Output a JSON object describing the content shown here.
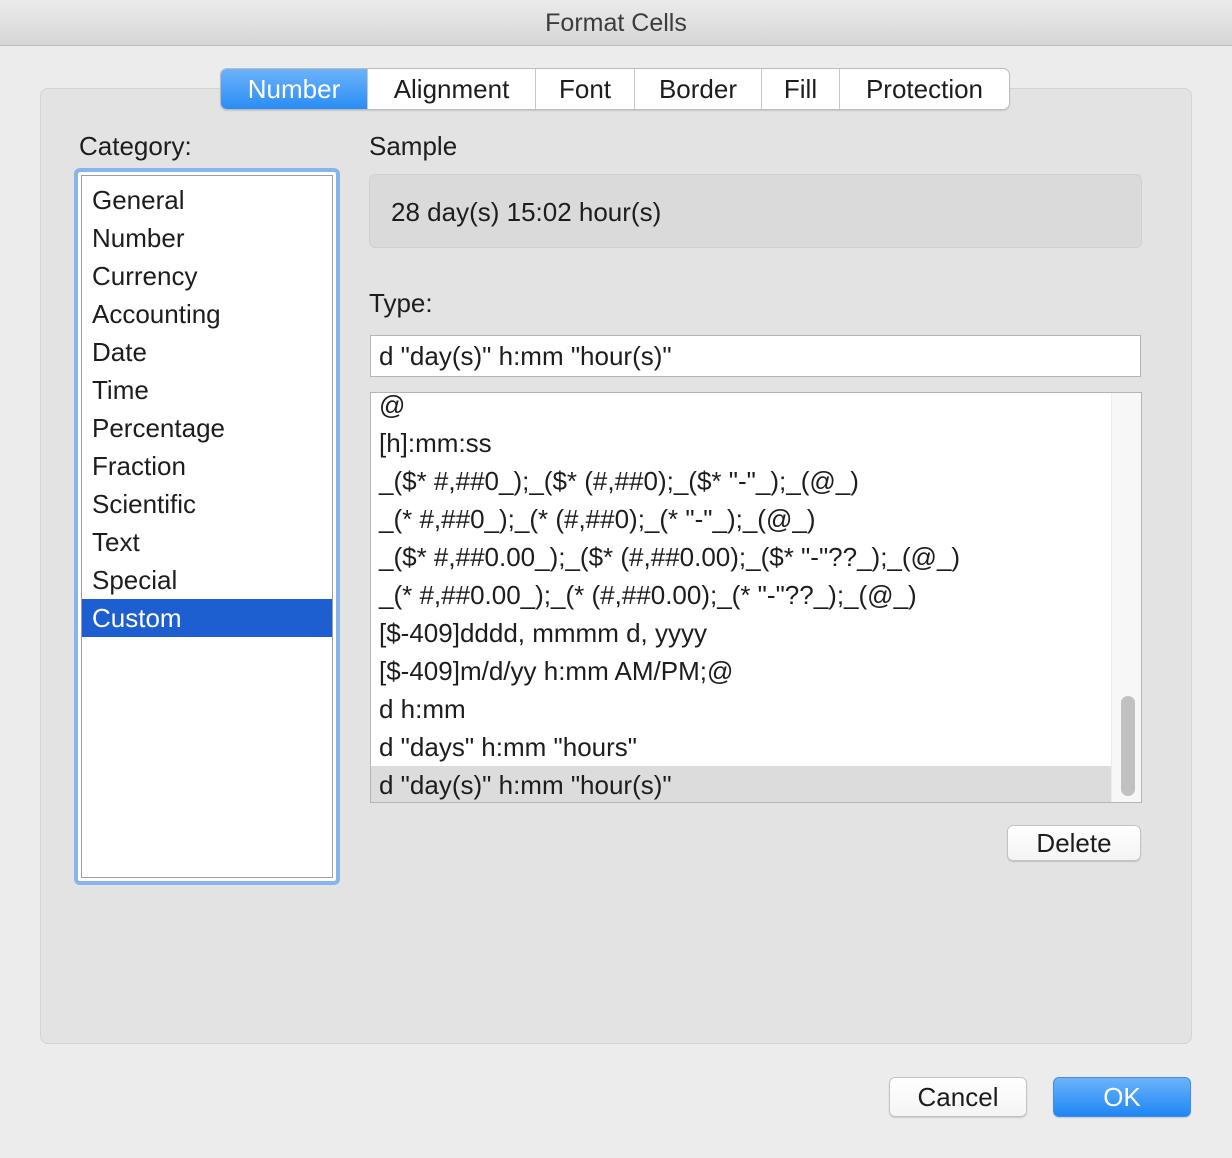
{
  "window": {
    "title": "Format Cells"
  },
  "tabs": [
    {
      "label": "Number",
      "active": true
    },
    {
      "label": "Alignment",
      "active": false
    },
    {
      "label": "Font",
      "active": false
    },
    {
      "label": "Border",
      "active": false
    },
    {
      "label": "Fill",
      "active": false
    },
    {
      "label": "Protection",
      "active": false
    }
  ],
  "category": {
    "label": "Category:",
    "selected": "Custom",
    "items": [
      "General",
      "Number",
      "Currency",
      "Accounting",
      "Date",
      "Time",
      "Percentage",
      "Fraction",
      "Scientific",
      "Text",
      "Special",
      "Custom"
    ]
  },
  "sample": {
    "label": "Sample",
    "value": "28 day(s) 15:02 hour(s)"
  },
  "type": {
    "label": "Type:",
    "value": "d \"day(s)\" h:mm \"hour(s)\"",
    "selected": "d \"day(s)\" h:mm \"hour(s)\"",
    "items": [
      "@",
      "[h]:mm:ss",
      "_($* #,##0_);_($* (#,##0);_($* \"-\"_);_(@_)",
      "_(* #,##0_);_(* (#,##0);_(* \"-\"_);_(@_)",
      "_($* #,##0.00_);_($* (#,##0.00);_($* \"-\"??_);_(@_)",
      "_(* #,##0.00_);_(* (#,##0.00);_(* \"-\"??_);_(@_)",
      "[$-409]dddd, mmmm d, yyyy",
      "[$-409]m/d/yy h:mm AM/PM;@",
      "d h:mm",
      "d \"days\" h:mm \"hours\"",
      "d \"day(s)\" h:mm \"hour(s)\""
    ]
  },
  "buttons": {
    "delete": "Delete",
    "cancel": "Cancel",
    "ok": "OK"
  },
  "colors": {
    "accent": "#2a8df5",
    "selection": "#1d5fd1",
    "focus_ring": "#86b5ee"
  }
}
